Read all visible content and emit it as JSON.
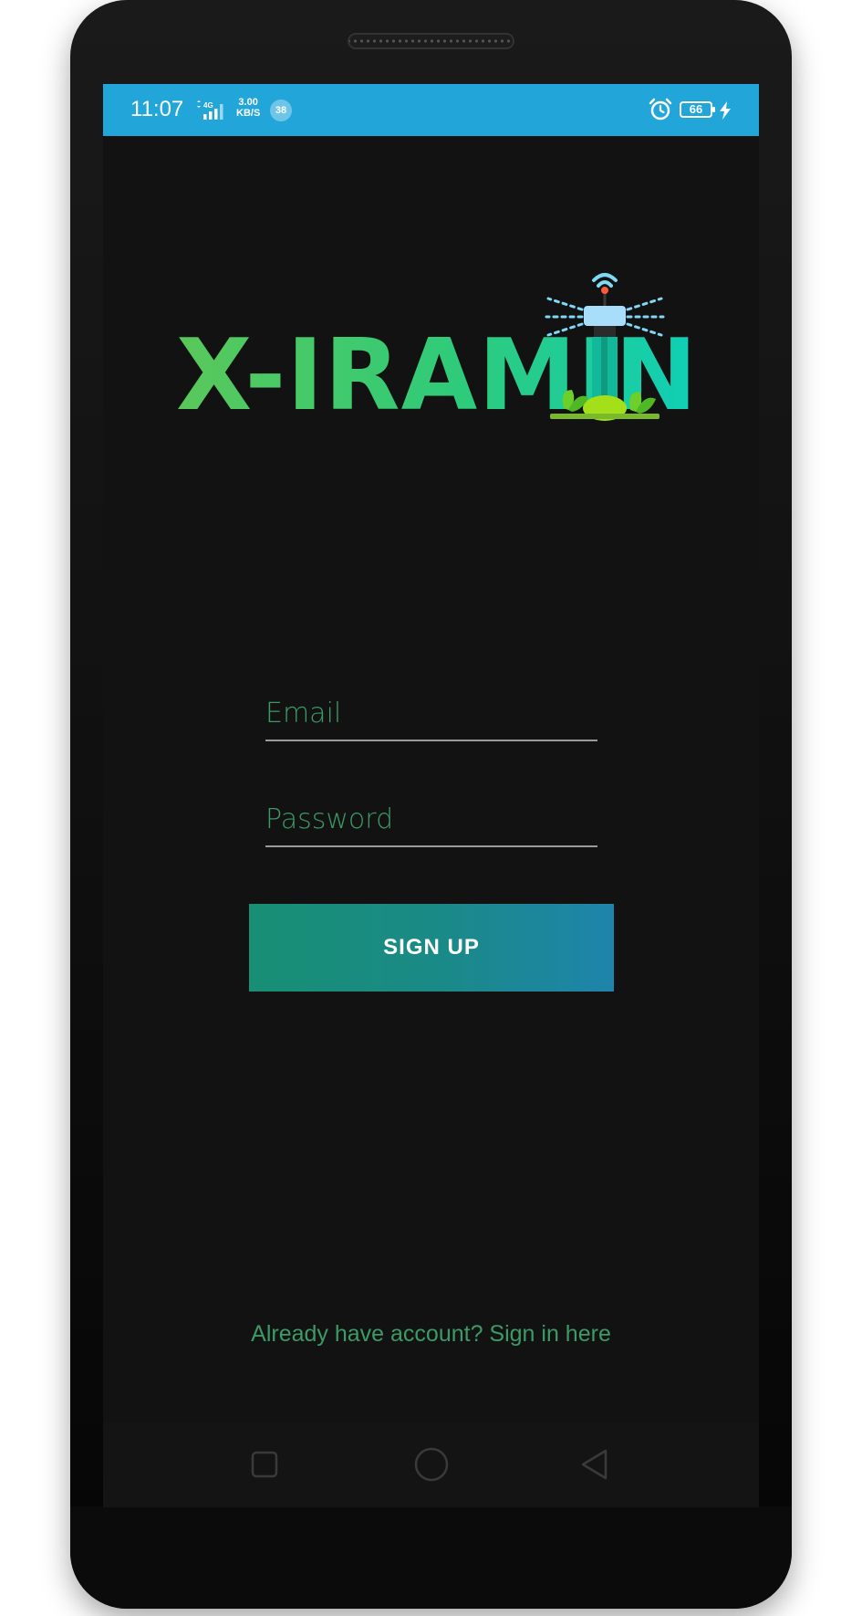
{
  "status_bar": {
    "time": "11:07",
    "network": "4G",
    "speed_value": "3.00",
    "speed_unit": "KB/S",
    "notification_count": "38",
    "battery_level": "66",
    "background_color": "#22a6da"
  },
  "logo": {
    "text": "X-IRAMIN"
  },
  "form": {
    "email_placeholder": "Email",
    "email_value": "",
    "password_placeholder": "Password",
    "password_value": "",
    "signup_label": "SIGN UP",
    "signin_link": "Already have account? Sign in here"
  },
  "nav": {
    "icons": [
      "recent-apps-icon",
      "home-icon",
      "back-icon"
    ]
  },
  "colors": {
    "screen_bg": "#121212",
    "accent_green": "#3c9a66",
    "button_start": "#188f74",
    "button_end": "#1e84ab"
  }
}
